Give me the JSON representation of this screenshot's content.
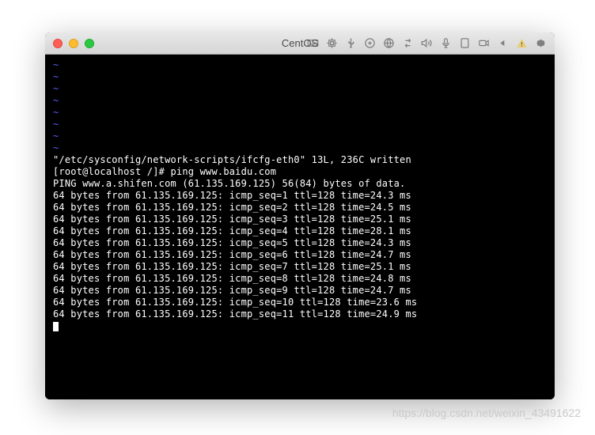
{
  "window": {
    "title": "CentOS"
  },
  "toolbar": {
    "icons": [
      "keyboard",
      "cpu",
      "usb",
      "disc",
      "network",
      "transfer",
      "sound",
      "mic",
      "tablet",
      "camera",
      "arrow",
      "warning",
      "gear"
    ]
  },
  "terminal": {
    "tilde_lines": [
      "~",
      "~",
      "~",
      "~",
      "~",
      "~",
      "~",
      "~"
    ],
    "write_msg": "\"/etc/sysconfig/network-scripts/ifcfg-eth0\" 13L, 236C written",
    "prompt_user": "[root@localhost /]#",
    "prompt_cmd": " ping www.baidu.com",
    "ping_header": "PING www.a.shifen.com (61.135.169.125) 56(84) bytes of data.",
    "replies": [
      "64 bytes from 61.135.169.125: icmp_seq=1 ttl=128 time=24.3 ms",
      "64 bytes from 61.135.169.125: icmp_seq=2 ttl=128 time=24.5 ms",
      "64 bytes from 61.135.169.125: icmp_seq=3 ttl=128 time=25.1 ms",
      "64 bytes from 61.135.169.125: icmp_seq=4 ttl=128 time=28.1 ms",
      "64 bytes from 61.135.169.125: icmp_seq=5 ttl=128 time=24.3 ms",
      "64 bytes from 61.135.169.125: icmp_seq=6 ttl=128 time=24.7 ms",
      "64 bytes from 61.135.169.125: icmp_seq=7 ttl=128 time=25.1 ms",
      "64 bytes from 61.135.169.125: icmp_seq=8 ttl=128 time=24.8 ms",
      "64 bytes from 61.135.169.125: icmp_seq=9 ttl=128 time=24.7 ms",
      "64 bytes from 61.135.169.125: icmp_seq=10 ttl=128 time=23.6 ms",
      "64 bytes from 61.135.169.125: icmp_seq=11 ttl=128 time=24.9 ms"
    ]
  },
  "watermark": "https://blog.csdn.net/weixin_43491622"
}
